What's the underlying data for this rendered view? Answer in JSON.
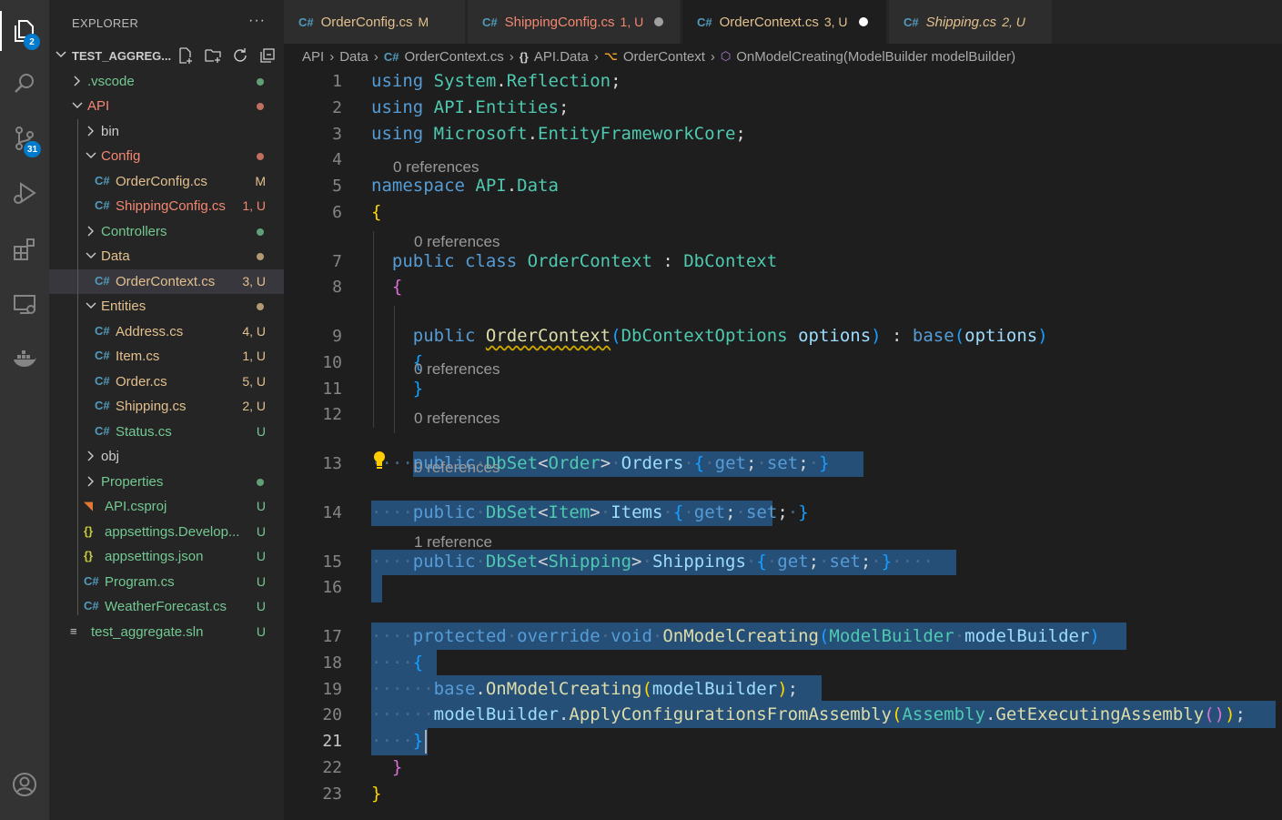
{
  "activity_bar": {
    "items": [
      {
        "name": "explorer",
        "icon": "files-icon",
        "badge": "2"
      },
      {
        "name": "search",
        "icon": "search-icon",
        "badge": ""
      },
      {
        "name": "source-control",
        "icon": "source-control-icon",
        "badge": "31"
      },
      {
        "name": "run-debug",
        "icon": "run-debug-icon",
        "badge": ""
      },
      {
        "name": "extensions",
        "icon": "extensions-icon",
        "badge": ""
      },
      {
        "name": "remote-explorer",
        "icon": "remote-explorer-icon",
        "badge": ""
      },
      {
        "name": "docker",
        "icon": "docker-icon",
        "badge": ""
      }
    ],
    "account_icon": "account-icon"
  },
  "sidebar": {
    "title": "EXPLORER",
    "more": "···",
    "root": "TEST_AGGREG...",
    "tree": [
      {
        "label": ".vscode",
        "depth": 0,
        "type": "folder",
        "open": false,
        "status": "",
        "color": "#73c991"
      },
      {
        "label": "API",
        "depth": 0,
        "type": "folder",
        "open": true,
        "status": "",
        "color": "#f48771"
      },
      {
        "label": "bin",
        "depth": 1,
        "type": "folder",
        "open": false,
        "status": "",
        "color": "#cccccc"
      },
      {
        "label": "Config",
        "depth": 1,
        "type": "folder",
        "open": true,
        "status": "",
        "color": "#f48771"
      },
      {
        "label": "OrderConfig.cs",
        "depth": 2,
        "type": "cs",
        "status": "M",
        "color": "#e2c08d"
      },
      {
        "label": "ShippingConfig.cs",
        "depth": 2,
        "type": "cs",
        "status": "1, U",
        "color": "#f48771"
      },
      {
        "label": "Controllers",
        "depth": 1,
        "type": "folder",
        "open": false,
        "status": "",
        "color": "#73c991"
      },
      {
        "label": "Data",
        "depth": 1,
        "type": "folder",
        "open": true,
        "status": "",
        "color": "#e2c08d"
      },
      {
        "label": "OrderContext.cs",
        "depth": 2,
        "type": "cs",
        "status": "3, U",
        "color": "#e2c08d",
        "selected": true
      },
      {
        "label": "Entities",
        "depth": 1,
        "type": "folder",
        "open": true,
        "status": "",
        "color": "#e2c08d"
      },
      {
        "label": "Address.cs",
        "depth": 2,
        "type": "cs",
        "status": "4, U",
        "color": "#e2c08d"
      },
      {
        "label": "Item.cs",
        "depth": 2,
        "type": "cs",
        "status": "1, U",
        "color": "#e2c08d"
      },
      {
        "label": "Order.cs",
        "depth": 2,
        "type": "cs",
        "status": "5, U",
        "color": "#e2c08d"
      },
      {
        "label": "Shipping.cs",
        "depth": 2,
        "type": "cs",
        "status": "2, U",
        "color": "#e2c08d"
      },
      {
        "label": "Status.cs",
        "depth": 2,
        "type": "cs",
        "status": "U",
        "color": "#73c991"
      },
      {
        "label": "obj",
        "depth": 1,
        "type": "folder",
        "open": false,
        "status": "",
        "color": "#cccccc"
      },
      {
        "label": "Properties",
        "depth": 1,
        "type": "folder",
        "open": false,
        "status": "",
        "color": "#73c991"
      },
      {
        "label": "API.csproj",
        "depth": 1,
        "type": "rss",
        "status": "U",
        "color": "#73c991"
      },
      {
        "label": "appsettings.Develop...",
        "depth": 1,
        "type": "json",
        "status": "U",
        "color": "#73c991"
      },
      {
        "label": "appsettings.json",
        "depth": 1,
        "type": "json",
        "status": "U",
        "color": "#73c991"
      },
      {
        "label": "Program.cs",
        "depth": 1,
        "type": "cs",
        "status": "U",
        "color": "#73c991"
      },
      {
        "label": "WeatherForecast.cs",
        "depth": 1,
        "type": "cs",
        "status": "U",
        "color": "#73c991"
      },
      {
        "label": "test_aggregate.sln",
        "depth": 0,
        "type": "sln",
        "status": "U",
        "color": "#73c991"
      }
    ]
  },
  "tabs": [
    {
      "label": "OrderConfig.cs",
      "status": "M",
      "color": "#e2c08d",
      "dot": false,
      "italic": false,
      "active": false
    },
    {
      "label": "ShippingConfig.cs",
      "status": "1, U",
      "color": "#f48771",
      "dot": true,
      "italic": false,
      "active": false
    },
    {
      "label": "OrderContext.cs",
      "status": "3, U",
      "color": "#e2c08d",
      "dot": true,
      "italic": false,
      "active": true
    },
    {
      "label": "Shipping.cs",
      "status": "2, U",
      "color": "#e2c08d",
      "dot": false,
      "italic": true,
      "active": false
    }
  ],
  "breadcrumb": {
    "parts": [
      "API",
      "Data",
      "OrderContext.cs",
      "API.Data",
      "OrderContext",
      "OnModelCreating(ModelBuilder modelBuilder)"
    ],
    "icons": [
      "",
      "",
      "cs-file-icon",
      "namespace-icon",
      "class-icon",
      "method-icon"
    ]
  },
  "editor": {
    "current_line": "21",
    "line_numbers": [
      "1",
      "2",
      "3",
      "4",
      "5",
      "6",
      "7",
      "8",
      "9",
      "10",
      "11",
      "12",
      "13",
      "14",
      "15",
      "16",
      "17",
      "18",
      "19",
      "20",
      "21",
      "22",
      "23"
    ],
    "lenses": [
      "0 references",
      "0 references",
      "0 references",
      "0 references",
      "0 references",
      "1 reference"
    ],
    "lines": [
      [
        [
          "kw",
          "using "
        ],
        [
          "ty",
          "System"
        ],
        [
          "pu",
          "."
        ],
        [
          "ty",
          "Reflection"
        ],
        [
          "pu",
          ";"
        ]
      ],
      [
        [
          "kw",
          "using "
        ],
        [
          "ty",
          "API"
        ],
        [
          "pu",
          "."
        ],
        [
          "ty",
          "Entities"
        ],
        [
          "pu",
          ";"
        ]
      ],
      [
        [
          "kw",
          "using "
        ],
        [
          "ty",
          "Microsoft"
        ],
        [
          "pu",
          "."
        ],
        [
          "ty",
          "EntityFrameworkCore"
        ],
        [
          "pu",
          ";"
        ]
      ],
      [],
      [
        [
          "kw",
          "namespace "
        ],
        [
          "ty",
          "API"
        ],
        [
          "pu",
          "."
        ],
        [
          "ty",
          "Data"
        ]
      ],
      [
        [
          "br1",
          "{"
        ]
      ],
      [
        [
          "pu",
          "  "
        ],
        [
          "kw",
          "public "
        ],
        [
          "kw",
          "class "
        ],
        [
          "ty",
          "OrderContext"
        ],
        [
          "pu",
          " : "
        ],
        [
          "ty",
          "DbContext"
        ]
      ],
      [
        [
          "pu",
          "  "
        ],
        [
          "br2",
          "{"
        ]
      ],
      [
        [
          "pu",
          "    "
        ],
        [
          "kw",
          "public "
        ],
        [
          "fn",
          "OrderContext"
        ],
        [
          "br3",
          "("
        ],
        [
          "ty",
          "DbContextOptions"
        ],
        [
          "pu",
          " "
        ],
        [
          "va",
          "options"
        ],
        [
          "br3",
          ")"
        ],
        [
          "pu",
          " : "
        ],
        [
          "kw",
          "base"
        ],
        [
          "br3",
          "("
        ],
        [
          "va",
          "options"
        ],
        [
          "br3",
          ")"
        ]
      ],
      [
        [
          "pu",
          "    "
        ],
        [
          "br3",
          "{"
        ]
      ],
      [
        [
          "pu",
          "    "
        ],
        [
          "br3",
          "}"
        ]
      ],
      [],
      [
        [
          "ws",
          "····"
        ],
        [
          "kw",
          "public"
        ],
        [
          "ws",
          "·"
        ],
        [
          "ty",
          "DbSet"
        ],
        [
          "pu",
          "<"
        ],
        [
          "ty",
          "Order"
        ],
        [
          "pu",
          ">"
        ],
        [
          "ws",
          "·"
        ],
        [
          "va",
          "Orders"
        ],
        [
          "ws",
          "·"
        ],
        [
          "br3",
          "{"
        ],
        [
          "ws",
          "·"
        ],
        [
          "kw",
          "get"
        ],
        [
          "pu",
          ";"
        ],
        [
          "ws",
          "·"
        ],
        [
          "kw",
          "set"
        ],
        [
          "pu",
          ";"
        ],
        [
          "ws",
          "·"
        ],
        [
          "br3",
          "}"
        ]
      ],
      [
        [
          "ws",
          "····"
        ],
        [
          "kw",
          "public"
        ],
        [
          "ws",
          "·"
        ],
        [
          "ty",
          "DbSet"
        ],
        [
          "pu",
          "<"
        ],
        [
          "ty",
          "Item"
        ],
        [
          "pu",
          ">"
        ],
        [
          "ws",
          "·"
        ],
        [
          "va",
          "Items"
        ],
        [
          "ws",
          "·"
        ],
        [
          "br3",
          "{"
        ],
        [
          "ws",
          "·"
        ],
        [
          "kw",
          "get"
        ],
        [
          "pu",
          ";"
        ],
        [
          "ws",
          "·"
        ],
        [
          "kw",
          "set"
        ],
        [
          "pu",
          ";"
        ],
        [
          "ws",
          "·"
        ],
        [
          "br3",
          "}"
        ]
      ],
      [
        [
          "ws",
          "····"
        ],
        [
          "kw",
          "public"
        ],
        [
          "ws",
          "·"
        ],
        [
          "ty",
          "DbSet"
        ],
        [
          "pu",
          "<"
        ],
        [
          "ty",
          "Shipping"
        ],
        [
          "pu",
          ">"
        ],
        [
          "ws",
          "·"
        ],
        [
          "va",
          "Shippings"
        ],
        [
          "ws",
          "·"
        ],
        [
          "br3",
          "{"
        ],
        [
          "ws",
          "·"
        ],
        [
          "kw",
          "get"
        ],
        [
          "pu",
          ";"
        ],
        [
          "ws",
          "·"
        ],
        [
          "kw",
          "set"
        ],
        [
          "pu",
          ";"
        ],
        [
          "ws",
          "·"
        ],
        [
          "br3",
          "}"
        ],
        [
          "ws",
          "····"
        ]
      ],
      [],
      [
        [
          "ws",
          "····"
        ],
        [
          "kw",
          "protected"
        ],
        [
          "ws",
          "·"
        ],
        [
          "kw",
          "override"
        ],
        [
          "ws",
          "·"
        ],
        [
          "kw",
          "void"
        ],
        [
          "ws",
          "·"
        ],
        [
          "fn",
          "OnModelCreating"
        ],
        [
          "br3",
          "("
        ],
        [
          "ty",
          "ModelBuilder"
        ],
        [
          "ws",
          "·"
        ],
        [
          "va",
          "modelBuilder"
        ],
        [
          "br3",
          ")"
        ]
      ],
      [
        [
          "ws",
          "····"
        ],
        [
          "br3",
          "{"
        ]
      ],
      [
        [
          "ws",
          "······"
        ],
        [
          "kw",
          "base"
        ],
        [
          "pu",
          "."
        ],
        [
          "fn",
          "OnModelCreating"
        ],
        [
          "br1",
          "("
        ],
        [
          "va",
          "modelBuilder"
        ],
        [
          "br1",
          ")"
        ],
        [
          "pu",
          ";"
        ]
      ],
      [
        [
          "ws",
          "······"
        ],
        [
          "va",
          "modelBuilder"
        ],
        [
          "pu",
          "."
        ],
        [
          "fn",
          "ApplyConfigurationsFromAssembly"
        ],
        [
          "br1",
          "("
        ],
        [
          "ty",
          "Assembly"
        ],
        [
          "pu",
          "."
        ],
        [
          "fn",
          "GetExecutingAssembly"
        ],
        [
          "br2",
          "()"
        ],
        [
          "br1",
          ")"
        ],
        [
          "pu",
          ";"
        ]
      ],
      [
        [
          "ws",
          "····"
        ],
        [
          "br3",
          "}"
        ]
      ],
      [
        [
          "pu",
          "  "
        ],
        [
          "br2",
          "}"
        ]
      ],
      [
        [
          "br1",
          "}"
        ]
      ]
    ]
  }
}
